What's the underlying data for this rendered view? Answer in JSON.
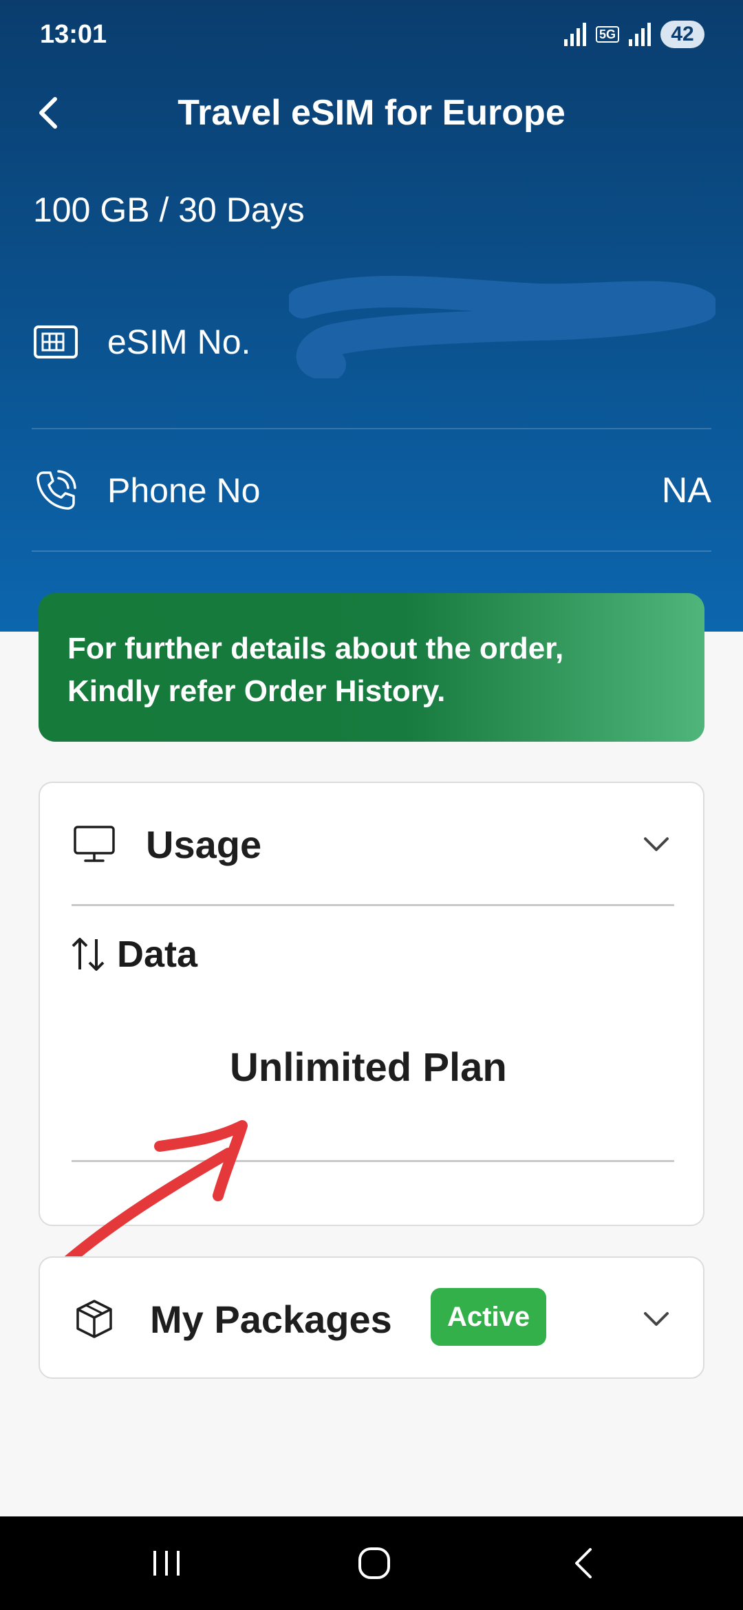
{
  "status_bar": {
    "time": "13:01",
    "network_label": "5G",
    "battery_level": "42"
  },
  "header": {
    "title": "Travel eSIM for Europe",
    "back_icon": "back-arrow-icon"
  },
  "plan": {
    "description": "100 GB / 30 Days"
  },
  "details": [
    {
      "label": "eSIM No.",
      "value": "",
      "icon": "sim-card-icon",
      "value_redacted": true
    },
    {
      "label": "Phone No",
      "value": "NA",
      "icon": "phone-icon"
    }
  ],
  "banner": {
    "line1": "For further details about the order,",
    "line2": "Kindly refer Order History.",
    "color": "#177a3e"
  },
  "usage": {
    "title": "Usage",
    "icon": "monitor-icon",
    "data_label": "Data",
    "data_icon": "up-down-arrows-icon",
    "plan_value": "Unlimited Plan",
    "expanded": true
  },
  "packages": {
    "title": "My Packages",
    "icon": "package-box-icon",
    "status": "Active",
    "status_color": "#33b04a",
    "expanded": false
  },
  "annotation": {
    "type": "hand-drawn red arrow",
    "color": "#e5383b"
  },
  "nav_bar": {
    "buttons": [
      "recent-apps",
      "home",
      "back"
    ]
  }
}
